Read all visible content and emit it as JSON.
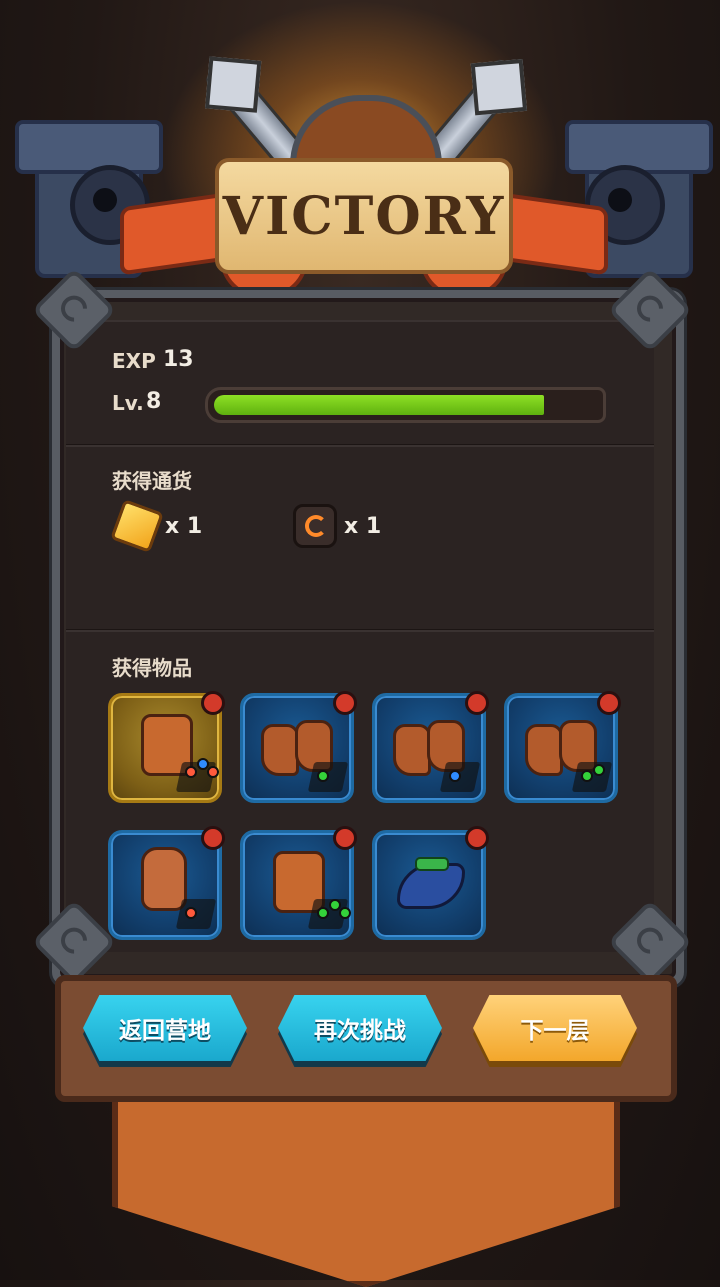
{
  "banner": {
    "title": "VICTORY"
  },
  "stats": {
    "exp_label": "EXP",
    "exp_value": "13",
    "level_label": "Lv.",
    "level_value": "8",
    "level_progress": 0.88
  },
  "currency": {
    "title": "获得通货",
    "items": [
      {
        "icon": "gold-crystal-icon",
        "qty": "x 1"
      },
      {
        "icon": "ore-rune-icon",
        "qty": "x 1"
      }
    ]
  },
  "items": {
    "title": "获得物品",
    "slots": [
      {
        "icon": "armor-icon",
        "rarity": "gold"
      },
      {
        "icon": "boots-icon",
        "rarity": "blue"
      },
      {
        "icon": "boots-icon",
        "rarity": "blue"
      },
      {
        "icon": "boots-icon",
        "rarity": "blue"
      },
      {
        "icon": "glove-icon",
        "rarity": "blue"
      },
      {
        "icon": "armor-icon",
        "rarity": "blue"
      },
      {
        "icon": "hat-icon",
        "rarity": "blue"
      }
    ]
  },
  "buttons": {
    "return_camp": "返回营地",
    "retry": "再次挑战",
    "next_floor": "下一层"
  },
  "colors": {
    "accent_blue": "#1aa8cd",
    "accent_orange": "#f3a72b",
    "xp_green": "#7ed321"
  }
}
